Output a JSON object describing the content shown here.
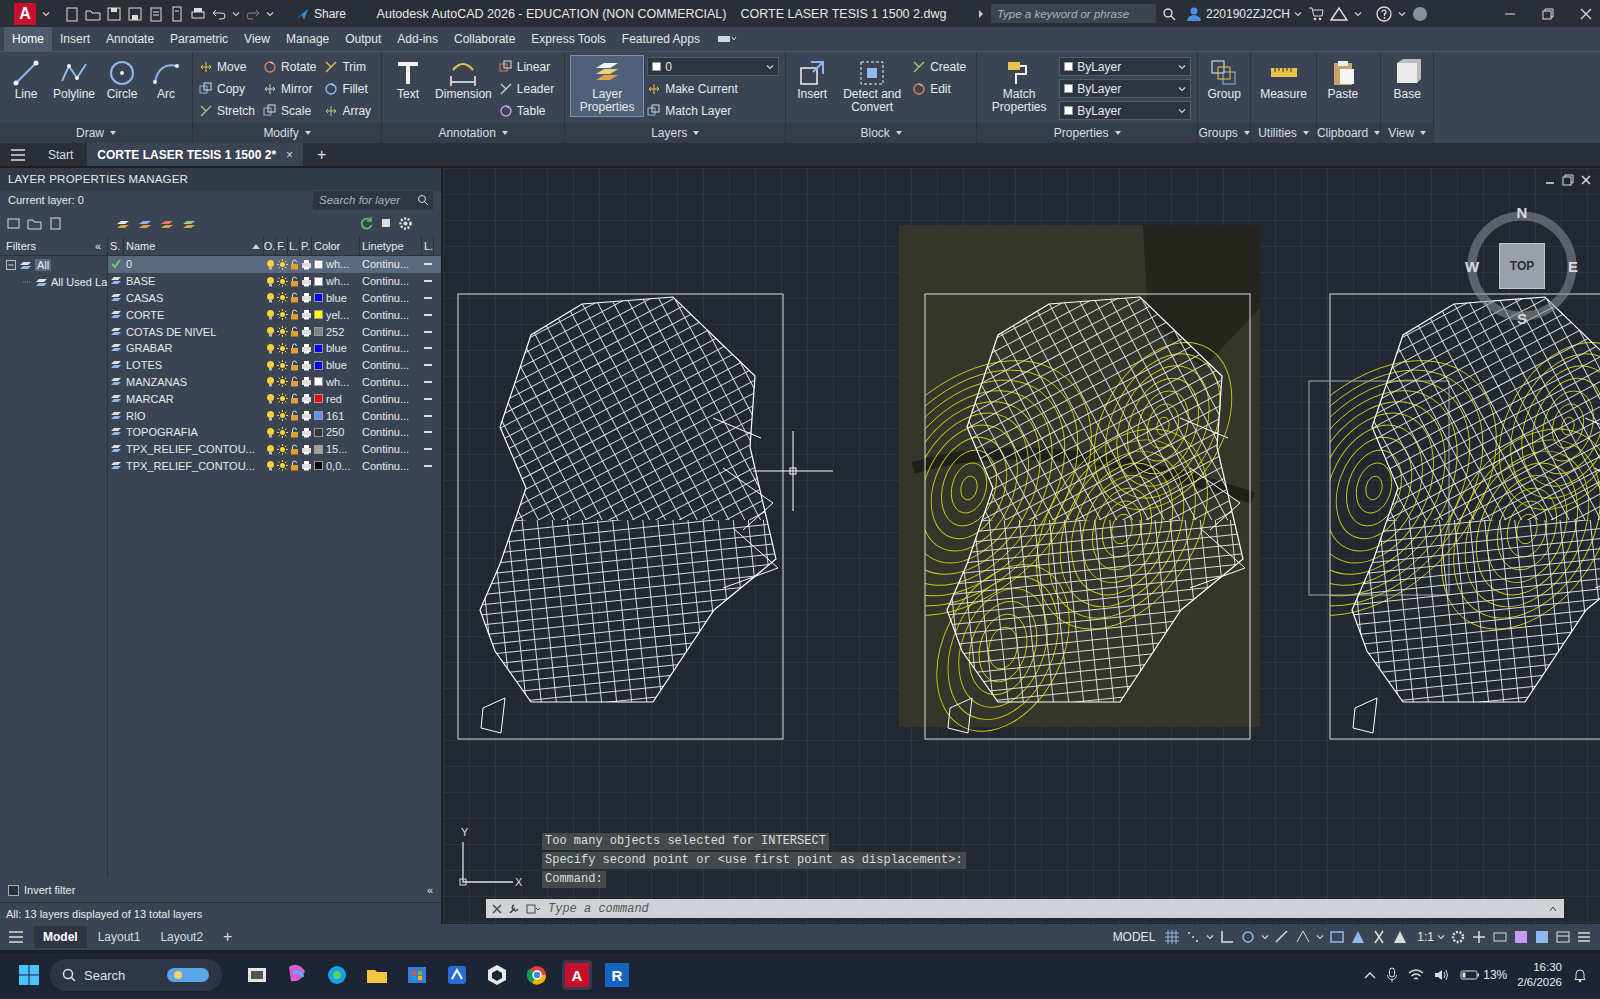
{
  "window": {
    "app_letter": "A",
    "share": "Share",
    "title": "Autodesk AutoCAD 2026 - EDUCATION (NON COMMERCIAL)",
    "file": "CORTE LASER TESIS 1 1500 2.dwg",
    "search_placeholder": "Type a keyword or phrase",
    "user": "2201902ZJ2CH"
  },
  "ribbon_tabs": [
    {
      "label": "Home",
      "selected": true
    },
    {
      "label": "Insert",
      "selected": false
    },
    {
      "label": "Annotate",
      "selected": false
    },
    {
      "label": "Parametric",
      "selected": false
    },
    {
      "label": "View",
      "selected": false
    },
    {
      "label": "Manage",
      "selected": false
    },
    {
      "label": "Output",
      "selected": false
    },
    {
      "label": "Add-ins",
      "selected": false
    },
    {
      "label": "Collaborate",
      "selected": false
    },
    {
      "label": "Express Tools",
      "selected": false
    },
    {
      "label": "Featured Apps",
      "selected": false
    }
  ],
  "ribbon_panels": [
    {
      "title": "Draw",
      "big": [
        {
          "label": "Line",
          "selected": false
        },
        {
          "label": "Polyline",
          "selected": false
        },
        {
          "label": "Circle",
          "selected": false
        },
        {
          "label": "Arc",
          "selected": false
        }
      ],
      "columns": []
    },
    {
      "title": "Modify",
      "big": [],
      "columns": [
        [
          {
            "label": "Move",
            "kind": "button"
          },
          {
            "label": "Copy",
            "kind": "button"
          },
          {
            "label": "Stretch",
            "kind": "button"
          }
        ],
        [
          {
            "label": "Rotate",
            "kind": "button"
          },
          {
            "label": "Mirror",
            "kind": "button"
          },
          {
            "label": "Scale",
            "kind": "button"
          }
        ],
        [
          {
            "label": "Trim",
            "kind": "button"
          },
          {
            "label": "Fillet",
            "kind": "button"
          },
          {
            "label": "Array",
            "kind": "button"
          }
        ]
      ]
    },
    {
      "title": "Annotation",
      "big": [
        {
          "label": "Text",
          "selected": false
        },
        {
          "label": "Dimension",
          "selected": false
        }
      ],
      "columns": [
        [
          {
            "label": "Linear",
            "kind": "button"
          },
          {
            "label": "Leader",
            "kind": "button"
          },
          {
            "label": "Table",
            "kind": "button"
          }
        ]
      ]
    },
    {
      "title": "Layers",
      "big": [
        {
          "label": "Layer Properties",
          "selected": true
        }
      ],
      "columns": [
        [
          {
            "label": "0",
            "kind": "dropdown"
          },
          {
            "label": "Make Current",
            "kind": "button"
          },
          {
            "label": "Match Layer",
            "kind": "button"
          }
        ]
      ]
    },
    {
      "title": "Block",
      "big": [
        {
          "label": "Insert",
          "selected": false
        },
        {
          "label": "Detect and Convert",
          "selected": false
        }
      ],
      "columns": [
        [
          {
            "label": "Create",
            "kind": "button"
          },
          {
            "label": "Edit",
            "kind": "button"
          }
        ]
      ]
    },
    {
      "title": "Properties",
      "big": [
        {
          "label": "Match Properties",
          "selected": false
        }
      ],
      "columns": [
        [
          {
            "label": "ByLayer",
            "kind": "dropdown"
          },
          {
            "label": "ByLayer",
            "kind": "dropdown"
          },
          {
            "label": "ByLayer",
            "kind": "dropdown"
          }
        ]
      ]
    },
    {
      "title": "Groups",
      "big": [
        {
          "label": "Group",
          "selected": false
        }
      ],
      "columns": []
    },
    {
      "title": "Utilities",
      "big": [
        {
          "label": "Measure",
          "selected": false
        }
      ],
      "columns": []
    },
    {
      "title": "Clipboard",
      "big": [
        {
          "label": "Paste",
          "selected": false
        }
      ],
      "columns": []
    },
    {
      "title": "View",
      "big": [
        {
          "label": "Base",
          "selected": false
        }
      ],
      "columns": []
    }
  ],
  "doc_tabs": {
    "tabs": [
      {
        "label": "Start",
        "selected": false
      },
      {
        "label": "CORTE LASER TESIS 1 1500 2*",
        "selected": true,
        "close": "×"
      }
    ],
    "add": "+"
  },
  "layer_manager": {
    "title": "LAYER PROPERTIES MANAGER",
    "current": "Current layer: 0",
    "search_placeholder": "Search for layer",
    "filters_label": "Filters",
    "collapse": "«",
    "tree": [
      {
        "label": "All",
        "selected": true
      },
      {
        "label": "All Used La",
        "selected": false
      }
    ],
    "columns": [
      "S.",
      "Name",
      "O.",
      "F.",
      "L.",
      "P.",
      "Color",
      "Linetype",
      "L."
    ],
    "rows": [
      {
        "name": "0",
        "current": true,
        "selected": true,
        "on": true,
        "frozen": false,
        "locked": false,
        "plot": true,
        "color_label": "wh...",
        "color": "#ffffff",
        "linetype": "Continu..."
      },
      {
        "name": "BASE",
        "current": false,
        "selected": false,
        "on": true,
        "frozen": false,
        "locked": false,
        "plot": true,
        "color_label": "wh...",
        "color": "#ffffff",
        "linetype": "Continu..."
      },
      {
        "name": "CASAS",
        "current": false,
        "selected": false,
        "on": true,
        "frozen": false,
        "locked": false,
        "plot": true,
        "color_label": "blue",
        "color": "#0000ff",
        "linetype": "Continu..."
      },
      {
        "name": "CORTE",
        "current": false,
        "selected": false,
        "on": true,
        "frozen": false,
        "locked": false,
        "plot": true,
        "color_label": "yel...",
        "color": "#ffff00",
        "linetype": "Continu..."
      },
      {
        "name": "COTAS DE NIVEL",
        "current": false,
        "selected": false,
        "on": true,
        "frozen": false,
        "locked": false,
        "plot": true,
        "color_label": "252",
        "color": "#808080",
        "linetype": "Continu..."
      },
      {
        "name": "GRABAR",
        "current": false,
        "selected": false,
        "on": true,
        "frozen": false,
        "locked": false,
        "plot": true,
        "color_label": "blue",
        "color": "#0000ff",
        "linetype": "Continu..."
      },
      {
        "name": "LOTES",
        "current": false,
        "selected": false,
        "on": true,
        "frozen": false,
        "locked": false,
        "plot": true,
        "color_label": "blue",
        "color": "#0000ff",
        "linetype": "Continu..."
      },
      {
        "name": "MANZANAS",
        "current": false,
        "selected": false,
        "on": true,
        "frozen": false,
        "locked": false,
        "plot": true,
        "color_label": "wh...",
        "color": "#ffffff",
        "linetype": "Continu..."
      },
      {
        "name": "MARCAR",
        "current": false,
        "selected": false,
        "on": true,
        "frozen": false,
        "locked": false,
        "plot": true,
        "color_label": "red",
        "color": "#ff0000",
        "linetype": "Continu..."
      },
      {
        "name": "RIO",
        "current": false,
        "selected": false,
        "on": true,
        "frozen": false,
        "locked": false,
        "plot": true,
        "color_label": "161",
        "color": "#6b8cff",
        "linetype": "Continu..."
      },
      {
        "name": "TOPOGRAFIA",
        "current": false,
        "selected": false,
        "on": true,
        "frozen": false,
        "locked": false,
        "plot": true,
        "color_label": "250",
        "color": "#333333",
        "linetype": "Continu..."
      },
      {
        "name": "TPX_RELIEF_CONTOU...",
        "current": false,
        "selected": false,
        "on": true,
        "frozen": false,
        "locked": false,
        "plot": true,
        "color_label": "15...",
        "color": "#a0a0a0",
        "linetype": "Continu..."
      },
      {
        "name": "TPX_RELIEF_CONTOU...",
        "current": false,
        "selected": false,
        "on": true,
        "frozen": false,
        "locked": false,
        "plot": true,
        "color_label": "0,0...",
        "color": "#000000",
        "linetype": "Continu..."
      }
    ],
    "invert_filter": {
      "label": "Invert filter",
      "checked": false
    },
    "footer": "All: 13 layers displayed of 13 total layers"
  },
  "viewcube": {
    "n": "N",
    "s": "S",
    "e": "E",
    "w": "W",
    "face": "TOP"
  },
  "ucs": {
    "y": "Y",
    "x": "X"
  },
  "command": {
    "history": [
      "Too many objects selected for INTERSECT",
      "Specify second point or <use first point as displacement>:",
      "Command:"
    ],
    "placeholder": "Type a command"
  },
  "layout_tabs": [
    {
      "label": "Model",
      "selected": true
    },
    {
      "label": "Layout1",
      "selected": false
    },
    {
      "label": "Layout2",
      "selected": false
    }
  ],
  "status_bar": {
    "add": "+",
    "mode": "MODEL",
    "scale": "1:1"
  },
  "taskbar": {
    "search": "Search",
    "autocad": "A",
    "revit": "R",
    "battery": "13%",
    "time": "16:30",
    "date": "2/6/2026"
  }
}
